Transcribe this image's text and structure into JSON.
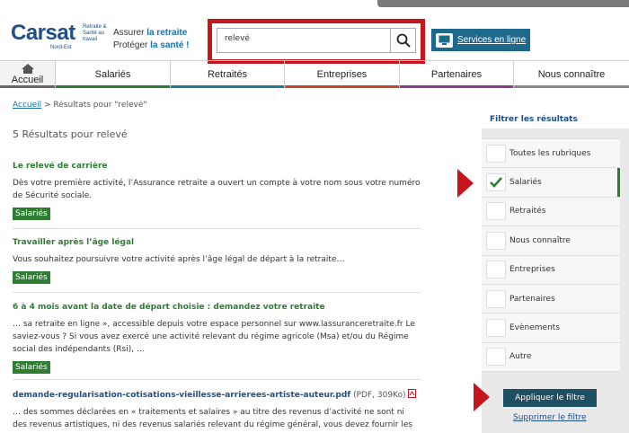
{
  "header": {
    "logo_main": "Carsat",
    "logo_side": "Retraite & Santé au travail",
    "logo_region": "Nord-Est",
    "tagline_line1_prefix": "Assurer ",
    "tagline_line1_strong": "la retraite",
    "tagline_line2_prefix": "Protéger ",
    "tagline_line2_strong": "la santé !",
    "search_value": "relevé",
    "services_label": "Services en ligne"
  },
  "nav": {
    "home": "Accueil",
    "items": [
      {
        "label": "Salariés",
        "color": "#2e7d32"
      },
      {
        "label": "Retraités",
        "color": "#1f7a9a"
      },
      {
        "label": "Entreprises",
        "color": "#c7472a"
      },
      {
        "label": "Partenaires",
        "color": "#8a3a8a"
      },
      {
        "label": "Nous connaître",
        "color": "#888888"
      }
    ]
  },
  "breadcrumb": {
    "home": "Accueil",
    "current": " > Résultats pour \"relevé\""
  },
  "results_title": "5 Résultats pour relevé",
  "results": [
    {
      "title": "Le relevé de carrière",
      "text": "Dès votre première activité, l’Assurance retraite a ouvert un compte à votre nom sous votre numéro de Sécurité sociale.",
      "tag": "Salariés"
    },
    {
      "title": "Travailler après l’âge légal",
      "text": "Vous souhaitez poursuivre votre activité après l’âge légal de départ à la retraite…",
      "tag": "Salariés"
    },
    {
      "title": "6 à 4 mois avant la date de départ choisie : demandez votre retraite",
      "text": "… sa retraite en ligne », accessible depuis votre espace personnel sur www.lassuranceretraite.fr Le saviez-vous ? Si vous avez exercé une activité relevant du régime agricole (Msa) et/ou du Régime social des indépendants (Rsi), …",
      "tag": "Salariés"
    },
    {
      "title": "demande-regularisation-cotisations-vieillesse-arrierees-artiste-auteur.pdf",
      "meta": " (PDF, 309Ko)",
      "text": "… des sommes déclarées en « traitements et salaires » au titre des revenus d’activité ne sont ni des revenus artistiques, ni des revenus salariés relevant du régime général, vous devez fournir les"
    }
  ],
  "filter": {
    "title": "Filtrer les résultats",
    "items": [
      "Toutes les rubriques",
      "Salariés",
      "Retraités",
      "Nous connaître",
      "Entreprises",
      "Partenaires",
      "Evènements",
      "Autre"
    ],
    "checked": "Salariés",
    "apply_label": "Appliquer le filtre",
    "clear_label": "Supprimer le filtre"
  },
  "colors": {
    "accent_red": "#c4161c",
    "brand_blue": "#1e4f8a",
    "green": "#2e7d32"
  }
}
